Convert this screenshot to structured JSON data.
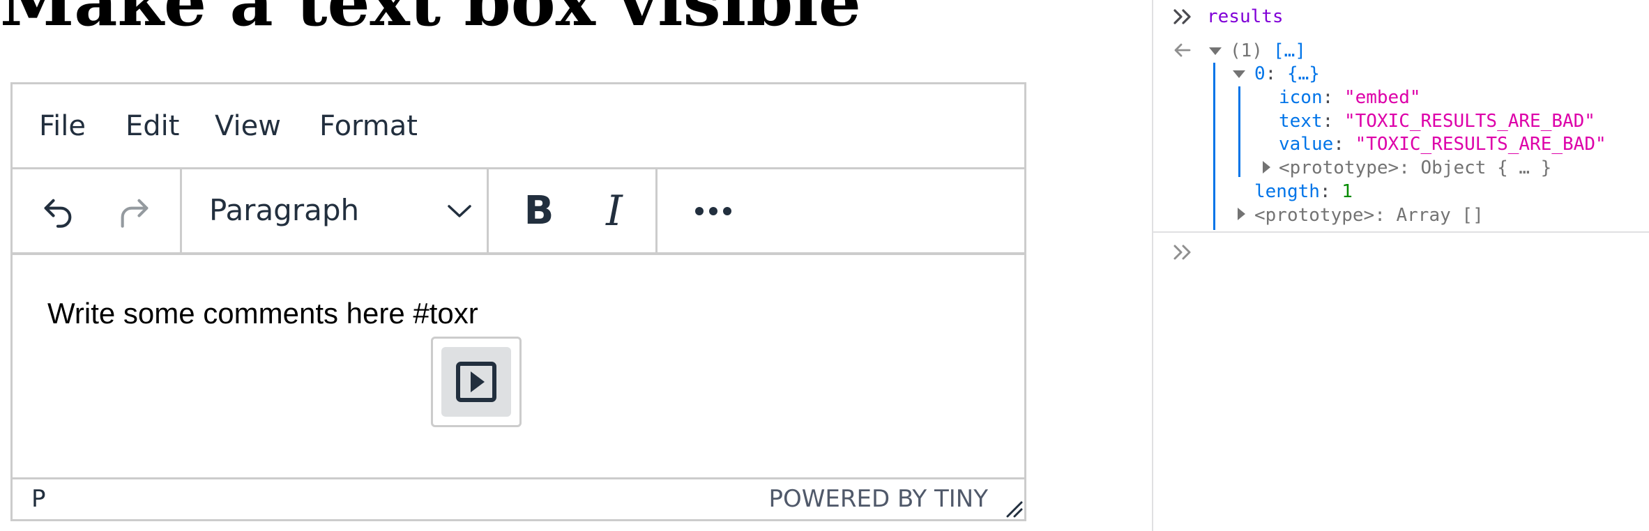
{
  "page": {
    "title": "Make a text box visible"
  },
  "editor": {
    "menubar": {
      "items": [
        {
          "label": "File"
        },
        {
          "label": "Edit"
        },
        {
          "label": "View"
        },
        {
          "label": "Format"
        }
      ]
    },
    "toolbar": {
      "undo_icon": "undo-icon",
      "redo_icon": "redo-icon",
      "block_format": "Paragraph",
      "bold_label": "B",
      "italic_label": "I",
      "more_icon": "more-icon"
    },
    "content": {
      "text": "Write some comments here #toxr"
    },
    "autocomplete": {
      "item_icon": "embed-icon"
    },
    "statusbar": {
      "path": "P",
      "branding": "POWERED BY TINY"
    }
  },
  "console": {
    "command": "results",
    "result": {
      "summary_count": "(1)",
      "summary_brackets": "[…]",
      "index_key": "0",
      "index_value": "{…}",
      "icon_key": "icon",
      "icon_value": "\"embed\"",
      "text_key": "text",
      "text_value": "\"TOXIC_RESULTS_ARE_BAD\"",
      "value_key": "value",
      "value_value": "\"TOXIC_RESULTS_ARE_BAD\"",
      "obj_prototype_key": "<prototype>",
      "obj_prototype_value": "Object { … }",
      "length_key": "length",
      "length_value": "1",
      "arr_prototype_key": "<prototype>",
      "arr_prototype_value": "Array []"
    },
    "colors": {
      "command": "#8000d7",
      "key": "#0074e8",
      "string": "#dd00a9",
      "number": "#058b00"
    }
  }
}
